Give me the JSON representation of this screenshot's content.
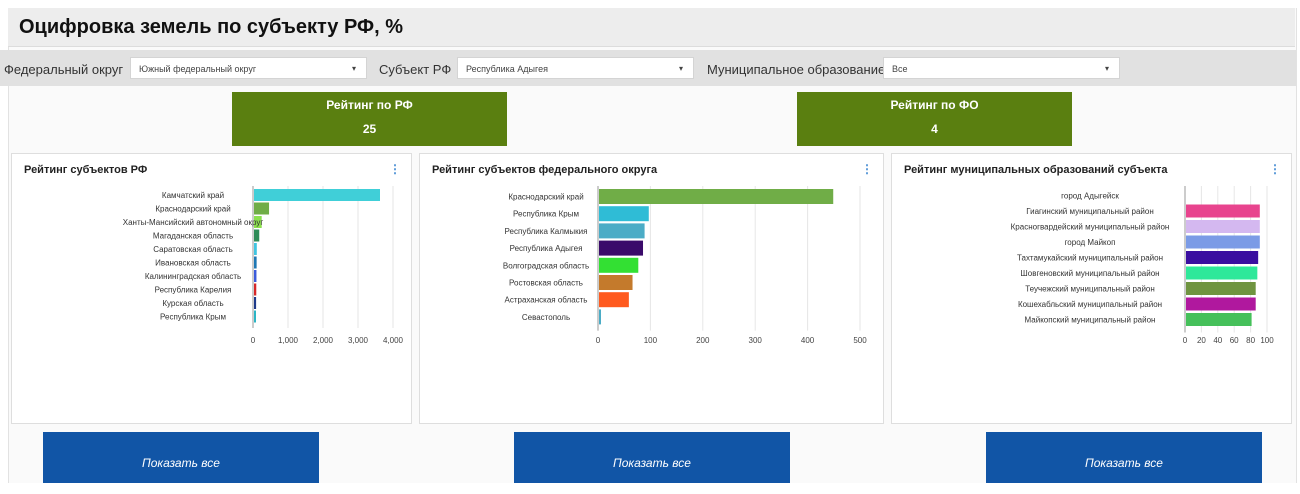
{
  "header": {
    "title": "Оцифровка земель по субъекту РФ, %"
  },
  "filters": {
    "federal_label": "Федеральный округ",
    "federal_value": "Южный федеральный округ",
    "subject_label": "Субъект РФ",
    "subject_value": "Республика Адыгея",
    "muni_label": "Муниципальное образование",
    "muni_value": "Все",
    "caret_icon": "▾"
  },
  "kpis": {
    "rf": {
      "title": "Рейтинг по РФ",
      "value": "25"
    },
    "fo": {
      "title": "Рейтинг по ФО",
      "value": "4"
    }
  },
  "panels": {
    "p1": {
      "title": "Рейтинг субъектов РФ",
      "menu_icon": "⋮"
    },
    "p2": {
      "title": "Рейтинг субъектов федерального округа",
      "menu_icon": "⋮"
    },
    "p3": {
      "title": "Рейтинг муниципальных образований субъекта",
      "menu_icon": "⋮"
    }
  },
  "buttons": {
    "show_all": "Показать все"
  },
  "chart_data": [
    {
      "type": "bar",
      "orientation": "horizontal",
      "categories": [
        "Камчатский край",
        "Краснодарский край",
        "Ханты-Мансийский автономный округ",
        "Магаданская область",
        "Саратовская область",
        "Ивановская область",
        "Калининградская область",
        "Республика Карелия",
        "Курская область",
        "Республика Крым"
      ],
      "values": [
        3600,
        430,
        220,
        150,
        80,
        75,
        70,
        65,
        60,
        55
      ],
      "colors": [
        "#40cfd8",
        "#70ad47",
        "#8be04e",
        "#2e8b57",
        "#40c4e0",
        "#1f78b4",
        "#3b5bdb",
        "#d62728",
        "#1e3a8a",
        "#2bb5c5"
      ],
      "xlim": [
        0,
        4000
      ],
      "xticks": [
        "0",
        "1,000",
        "2,000",
        "3,000",
        "4,000"
      ],
      "grid": true
    },
    {
      "type": "bar",
      "orientation": "horizontal",
      "categories": [
        "Краснодарский край",
        "Республика Крым",
        "Республика Калмыкия",
        "Республика Адыгея",
        "Волгоградская область",
        "Ростовская область",
        "Астраханская область",
        "Севастополь"
      ],
      "values": [
        447,
        95,
        87,
        84,
        75,
        64,
        57,
        3
      ],
      "colors": [
        "#70ad47",
        "#2fbcd6",
        "#4bacc6",
        "#3a0a6a",
        "#33e033",
        "#c47a2c",
        "#ff5a1f",
        "#4bacc6"
      ],
      "xlim": [
        0,
        500
      ],
      "xticks": [
        "0",
        "100",
        "200",
        "300",
        "400",
        "500"
      ],
      "grid": true
    },
    {
      "type": "bar",
      "orientation": "horizontal",
      "categories": [
        "город Адыгейск",
        "Гиагинский муниципальный район",
        "Красногвардейский муниципальный район",
        "город Майкоп",
        "Тахтамукайский муниципальный район",
        "Шовгеновский муниципальный район",
        "Теучежский муниципальный район",
        "Кошехабльский муниципальный район",
        "Майкопский муниципальный район"
      ],
      "values": [
        0,
        90,
        90,
        90,
        88,
        87,
        85,
        85,
        80
      ],
      "colors": [
        "#e8e8e8",
        "#e8448e",
        "#d4b8f0",
        "#7b9be6",
        "#3a0ea0",
        "#2ee89a",
        "#6f9440",
        "#b0189e",
        "#45c05a"
      ],
      "xlim": [
        0,
        100
      ],
      "xticks": [
        "0",
        "20",
        "40",
        "60",
        "80",
        "100"
      ],
      "grid": true
    }
  ]
}
